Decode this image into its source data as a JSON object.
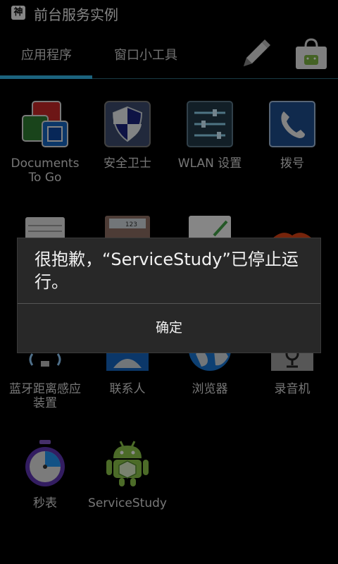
{
  "titlebar": {
    "icon_text": "神",
    "title": "前台服务实例"
  },
  "tabs": {
    "apps": "应用程序",
    "widgets": "窗口小工具",
    "accent": "#33b5e5"
  },
  "toolbar": {
    "pencil_icon": "pencil-icon",
    "market_icon": "market-bag-icon"
  },
  "apps": [
    {
      "label": "Documents\nTo Go",
      "icon": "documents-to-go-icon"
    },
    {
      "label": "安全卫士",
      "icon": "shield-icon"
    },
    {
      "label": "WLAN 设置",
      "icon": "wlan-settings-icon"
    },
    {
      "label": "拨号",
      "icon": "phone-icon"
    },
    {
      "label": "",
      "icon": "notes-icon"
    },
    {
      "label": "",
      "icon": "calculator-icon"
    },
    {
      "label": "",
      "icon": "memo-icon"
    },
    {
      "label": "",
      "icon": "handshake-icon"
    },
    {
      "label": "蓝牙距离感应\n装置",
      "icon": "bluetooth-icon"
    },
    {
      "label": "联系人",
      "icon": "contacts-icon"
    },
    {
      "label": "浏览器",
      "icon": "browser-icon"
    },
    {
      "label": "录音机",
      "icon": "recorder-icon"
    },
    {
      "label": "秒表",
      "icon": "stopwatch-icon"
    },
    {
      "label": "ServiceStudy",
      "icon": "android-icon"
    }
  ],
  "dialog": {
    "message": "很抱歉，“ServiceStudy”已停止运行。",
    "ok_button": "确定"
  }
}
